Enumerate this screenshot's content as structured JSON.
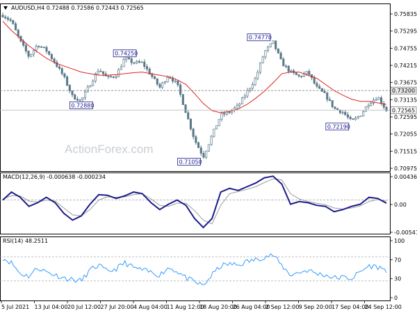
{
  "header": {
    "symbol_line": "AUDUSD,H4  0.72488 0.72586 0.72443 0.72565",
    "macd_line": "MACD(12,26,9) -0.000638 -0.000234",
    "rsi_line": "RSI(14) 48.2511"
  },
  "watermark": "ActionForex.com",
  "colors": {
    "candle": "#5a7a8a",
    "sma": "#e02020",
    "macd": "#1a1a8c",
    "macd_signal": "#9a9a9a",
    "rsi": "#1e90ff",
    "annotation_border": "#1a1a8c",
    "level_line": "#888888"
  },
  "chart_data": [
    {
      "type": "candlestick",
      "panel": "price",
      "ylim": [
        0.7063,
        0.7596
      ],
      "y_ticks": [
        "0.75835",
        "0.75295",
        "0.74755",
        "0.74215",
        "0.73675",
        "0.73135",
        "0.72595",
        "0.72055",
        "0.71515",
        "0.70975"
      ],
      "x_ticks": [
        "5 Jul 2021",
        "13 Jul 04:00",
        "20 Jul 12:00",
        "27 Jul 20:00",
        "4 Aug 04:00",
        "11 Aug 12:00",
        "18 Aug 20:00",
        "26 Aug 04:00",
        "2 Sep 12:00",
        "9 Sep 20:00",
        "17 Sep 04:00",
        "24 Sep 12:00"
      ],
      "annotations": [
        "0.72880",
        "0.74250",
        "0.74770",
        "0.72190",
        "0.71050"
      ],
      "level_labels": [
        "0.73200",
        "0.72565"
      ],
      "series": [
        {
          "name": "price",
          "values": [
            0.7565,
            0.7545,
            0.748,
            0.743,
            0.747,
            0.745,
            0.741,
            0.7365,
            0.73,
            0.7288,
            0.734,
            0.739,
            0.736,
            0.737,
            0.7425,
            0.741,
            0.741,
            0.737,
            0.733,
            0.737,
            0.734,
            0.725,
            0.716,
            0.7105,
            0.7175,
            0.724,
            0.725,
            0.727,
            0.7315,
            0.736,
            0.7445,
            0.7477,
            0.741,
            0.738,
            0.7365,
            0.738,
            0.733,
            0.7305,
            0.7262,
            0.725,
            0.7219,
            0.724,
            0.728,
            0.73,
            0.7256
          ]
        },
        {
          "name": "sma",
          "values": [
            0.7545,
            0.7515,
            0.749,
            0.7465,
            0.7445,
            0.7425,
            0.741,
            0.74,
            0.739,
            0.738,
            0.7375,
            0.737,
            0.737,
            0.7372,
            0.7375,
            0.7378,
            0.738,
            0.7375,
            0.737,
            0.7365,
            0.7355,
            0.734,
            0.731,
            0.7278,
            0.7255,
            0.7248,
            0.7252,
            0.726,
            0.7275,
            0.7295,
            0.7318,
            0.7345,
            0.7375,
            0.738,
            0.738,
            0.737,
            0.736,
            0.734,
            0.732,
            0.7305,
            0.7292,
            0.7285,
            0.7285,
            0.728,
            0.7275
          ]
        }
      ]
    },
    {
      "type": "line",
      "panel": "macd",
      "ylim": [
        -0.0061,
        0.0048
      ],
      "y_ticks": [
        "0.004367",
        "0.00",
        "-0.005411"
      ],
      "series": [
        {
          "name": "MACD(12,26,9)",
          "values": [
            0.0,
            0.0015,
            0.0005,
            -0.0012,
            -0.0005,
            0.0005,
            -0.0005,
            -0.0025,
            -0.0038,
            -0.003,
            -0.0008,
            0.001,
            0.0009,
            0.0003,
            0.0008,
            0.0015,
            0.0012,
            -0.0005,
            -0.0018,
            -0.0008,
            0.0,
            -0.001,
            -0.0035,
            -0.0052,
            -0.0035,
            0.0015,
            0.0022,
            0.0018,
            0.0025,
            0.0032,
            0.0042,
            0.0045,
            0.003,
            -0.0008,
            -0.0003,
            -0.0005,
            -0.001,
            -0.0012,
            -0.0022,
            -0.0018,
            -0.0012,
            -0.0008,
            0.0005,
            0.0003,
            -0.0006
          ]
        },
        {
          "name": "signal",
          "values": [
            0.0002,
            0.0008,
            0.0008,
            -0.0002,
            -0.0004,
            0.0,
            -0.0002,
            -0.0015,
            -0.0028,
            -0.003,
            -0.0018,
            0.0,
            0.0006,
            0.0005,
            0.0006,
            0.001,
            0.0012,
            0.0002,
            -0.001,
            -0.0012,
            -0.0006,
            -0.0006,
            -0.002,
            -0.0038,
            -0.0045,
            -0.001,
            0.0012,
            0.0016,
            0.002,
            0.0025,
            0.0033,
            0.004,
            0.0038,
            0.0012,
            0.0002,
            -0.0003,
            -0.0006,
            -0.0009,
            -0.0015,
            -0.0017,
            -0.0015,
            -0.0011,
            -0.0003,
            0.0001,
            -0.0002
          ]
        }
      ]
    },
    {
      "type": "line",
      "panel": "rsi",
      "ylim": [
        0,
        100
      ],
      "y_ticks": [
        "100",
        "70",
        "30",
        "0"
      ],
      "series": [
        {
          "name": "RSI(14)",
          "values": [
            68,
            60,
            42,
            38,
            52,
            45,
            40,
            35,
            32,
            30,
            48,
            56,
            45,
            50,
            60,
            52,
            48,
            44,
            40,
            52,
            46,
            35,
            28,
            22,
            40,
            55,
            58,
            56,
            62,
            65,
            70,
            73,
            55,
            40,
            44,
            48,
            42,
            40,
            35,
            36,
            34,
            45,
            55,
            53,
            48
          ]
        }
      ]
    }
  ]
}
